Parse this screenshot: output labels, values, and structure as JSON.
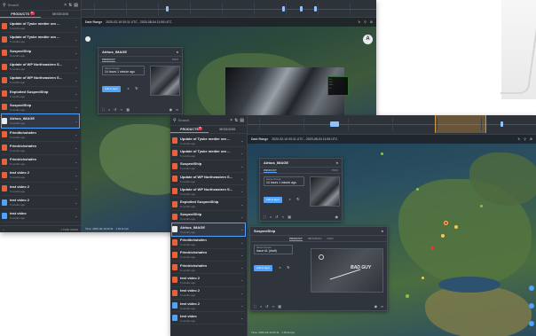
{
  "search": {
    "placeholder": "Search"
  },
  "tabs": {
    "products": "PRODUCTS",
    "missions": "MISSIONS",
    "badge": "5"
  },
  "items": [
    {
      "title": "Update of Tyske medier om ...",
      "sub": "5 months ago",
      "color": "#e8613a"
    },
    {
      "title": "Update of Tyske medier om ...",
      "sub": "5 months ago",
      "color": "#e8613a"
    },
    {
      "title": "SuspectShip",
      "sub": "5 months ago",
      "color": "#e8613a"
    },
    {
      "title": "Update of WP Northeastern S...",
      "sub": "5 months ago",
      "color": "#e8613a"
    },
    {
      "title": "Update of WP Northeastern S...",
      "sub": "5 months ago",
      "color": "#e8613a"
    },
    {
      "title": "Exploited SuspectShip",
      "sub": "5 months ago",
      "color": "#e8613a"
    },
    {
      "title": "SuspectShip",
      "sub": "5 months ago",
      "color": "#e8613a"
    },
    {
      "title": "Airbus_IMAGE",
      "sub": "5 months ago",
      "color": "#e9ecef"
    },
    {
      "title": "Frieditchshafen",
      "sub": "5 months ago",
      "color": "#e8613a"
    },
    {
      "title": "Friedrichshafen",
      "sub": "5 months ago",
      "color": "#e8613a"
    },
    {
      "title": "Friedrichshafen",
      "sub": "5 months ago",
      "color": "#e8613a"
    },
    {
      "title": "test video 2",
      "sub": "5 months ago",
      "color": "#e8613a"
    },
    {
      "title": "test video 2",
      "sub": "5 months ago",
      "color": "#e8613a"
    },
    {
      "title": "test video 2",
      "sub": "5 months ago",
      "color": "#4fa3ff"
    },
    {
      "title": "test video",
      "sub": "5 months ago",
      "color": "#4fa3ff"
    }
  ],
  "footerA": {
    "left": "+",
    "right": "1 TIME ITEMS"
  },
  "bar": {
    "range_label": "Date Range",
    "range": "2020-02-19 00:11 UTC - 2020-08-04 11:59 UTC"
  },
  "airbus": {
    "title": "Airbus_IMAGE",
    "tab1": "PRODUCT",
    "tab2": "INFO",
    "field_label": "Name of issue",
    "field_value": "14 hours 1 minute ago",
    "action": "Add to layer"
  },
  "ship": {
    "title": "SuspectShip",
    "tab1": "PRODUCT",
    "tab2": "METADATA",
    "tab3": "INFO",
    "field_label": "Name of issue",
    "field_value": "Issue #1 (draft)",
    "action": "Add to layer",
    "overlay": "BAD GUY"
  },
  "map_footer": {
    "left": "Time: 2020-02-19 00:11",
    "right": "1.33 km/px"
  },
  "avatar": "A",
  "colors": {
    "accent": "#4fa3ff",
    "badge": "#e8364e",
    "doc": "#e8613a",
    "range": "#d6943c"
  }
}
